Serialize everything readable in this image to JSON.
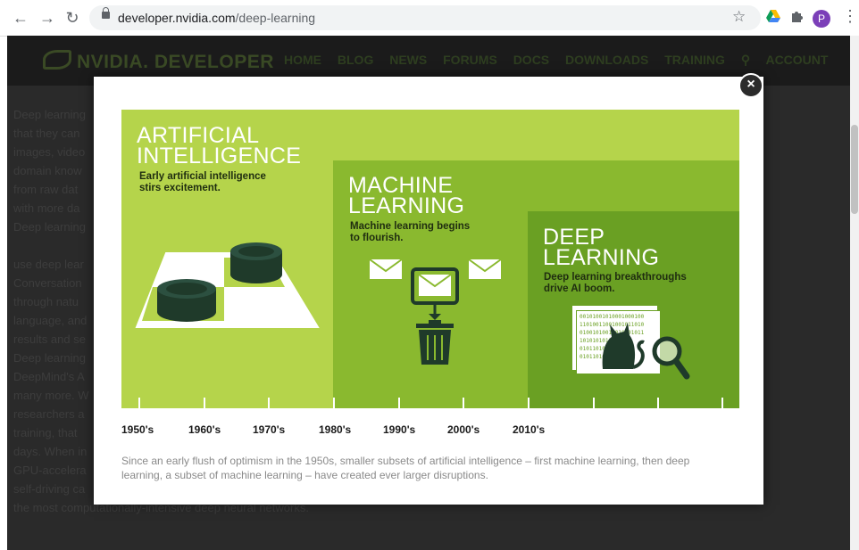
{
  "browser": {
    "url_host": "developer.nvidia.com",
    "url_path": "/deep-learning",
    "avatar_letter": "P"
  },
  "site": {
    "logo_text": "NVIDIA. DEVELOPER",
    "nav": [
      "HOME",
      "BLOG",
      "NEWS",
      "FORUMS",
      "DOCS",
      "DOWNLOADS",
      "TRAINING",
      "ACCOUNT"
    ],
    "body_lines": [
      "Deep learning",
      "that they can",
      "images, video",
      "domain know",
      "from raw dat",
      "with more da",
      "Deep learning",
      "",
      "use deep lear",
      "Conversation",
      "through natu",
      "language, and",
      "results and se",
      "Deep learning",
      "DeepMind's A",
      "many more. W",
      "researchers a",
      "training, that",
      "days. When in",
      "GPU-accelera",
      "self-driving ca",
      "the most computationally-intensive deep neural networks."
    ]
  },
  "modal": {
    "close_label": "×",
    "ai": {
      "title": [
        "ARTIFICIAL",
        "INTELLIGENCE"
      ],
      "subtitle": [
        "Early artificial intelligence",
        "stirs excitement."
      ]
    },
    "ml": {
      "title": [
        "MACHINE",
        "LEARNING"
      ],
      "subtitle": [
        "Machine learning begins",
        "to flourish."
      ]
    },
    "dl": {
      "title": [
        "DEEP",
        "LEARNING"
      ],
      "subtitle": [
        "Deep learning breakthroughs",
        "drive AI boom."
      ]
    },
    "binary_text": [
      "00101001010001000100",
      "11010011001001011010",
      "01001010010010101011",
      "101010101110",
      "010110101110",
      "01011010101101"
    ],
    "decades": [
      "1950's",
      "1960's",
      "1970's",
      "1980's",
      "1990's",
      "2000's",
      "2010's"
    ],
    "caption": "Since an early flush of optimism in the 1950s, smaller subsets of artificial intelligence – first machine learning, then deep learning, a subset of machine learning – have created ever larger disruptions."
  }
}
